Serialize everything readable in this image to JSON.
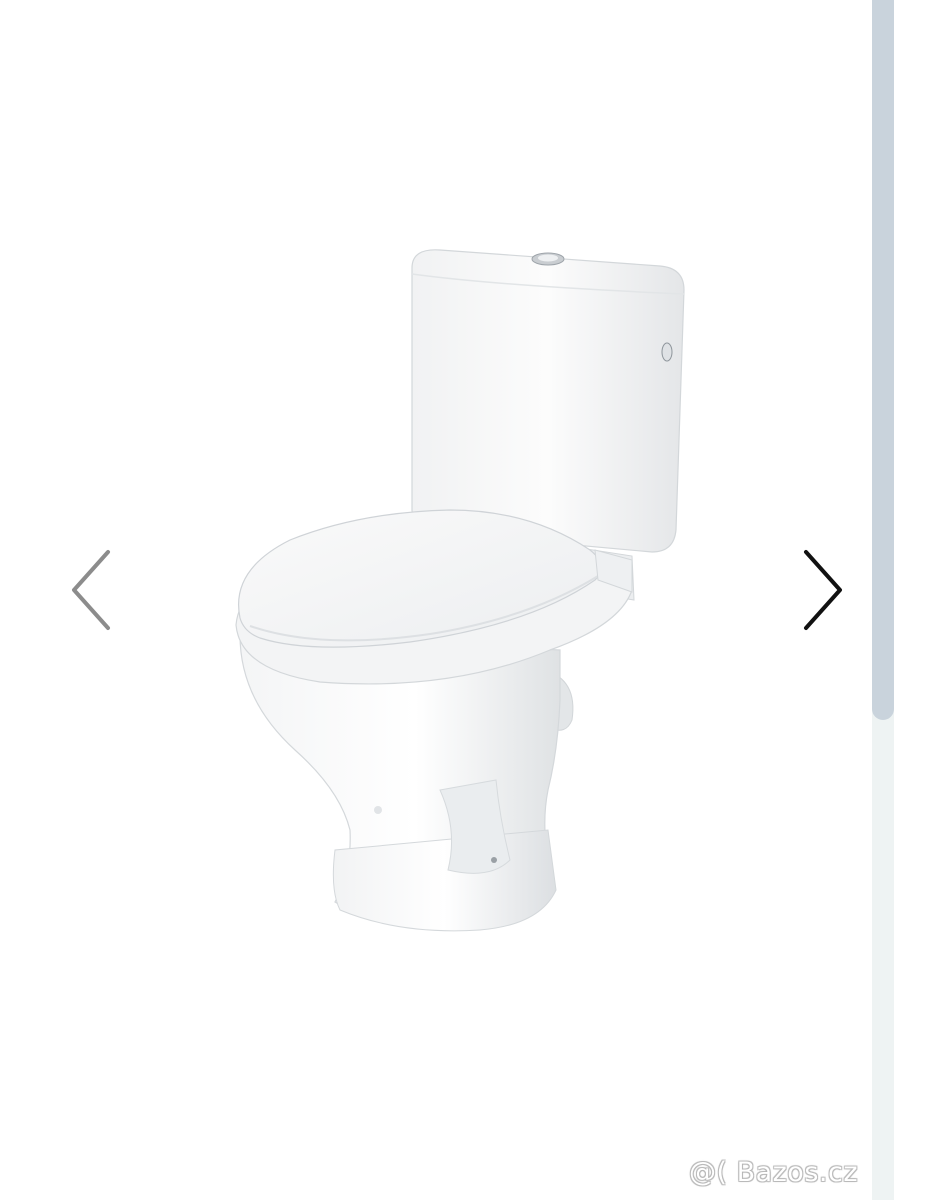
{
  "gallery": {
    "watermark": "@( Bazos.cz",
    "prev_icon": "chevron-left-icon",
    "next_icon": "chevron-right-icon",
    "image_subject": "toilet-photo"
  },
  "colors": {
    "prev_arrow": "#8c8c8c",
    "next_arrow": "#111111",
    "scroll_track": "#eef3f3",
    "scroll_thumb": "#c9d3dc",
    "background": "#ffffff"
  },
  "scrollbar": {
    "thumb_fraction": 0.6
  }
}
